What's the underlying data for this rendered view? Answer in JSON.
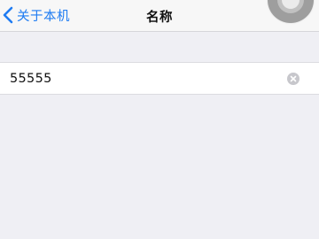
{
  "nav": {
    "back_label": "关于本机",
    "title": "名称"
  },
  "name_field": {
    "value": "55555"
  },
  "icons": {
    "back": "chevron-left-icon",
    "clear": "clear-x-icon",
    "assistive_touch": "assistive-touch-icon"
  },
  "colors": {
    "accent": "#1f7cf2",
    "background": "#efeff4",
    "nav_bar": "#f7f7f7",
    "cell": "#ffffff"
  }
}
